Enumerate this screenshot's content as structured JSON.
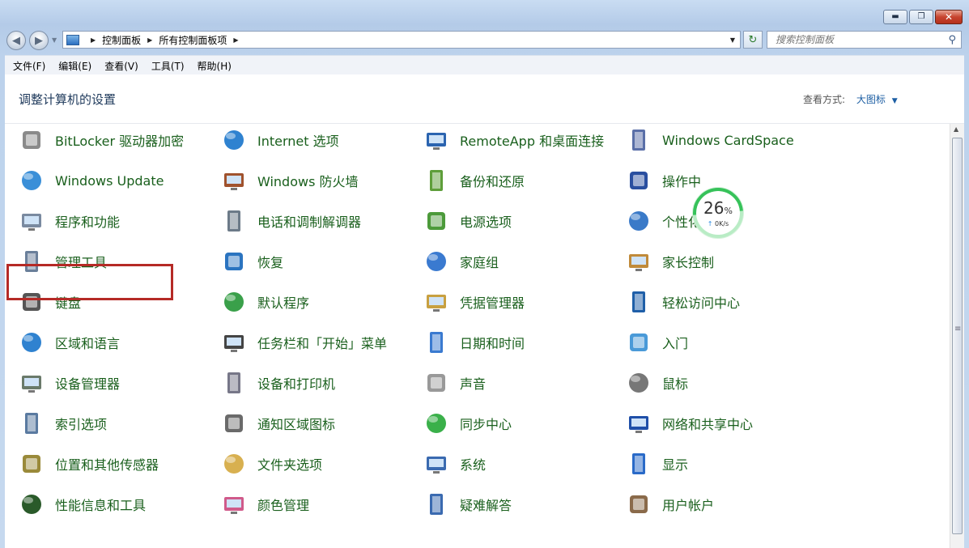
{
  "window": {
    "minimize_glyph": "▬",
    "maximize_glyph": "❐",
    "close_glyph": "✕"
  },
  "address_bar": {
    "crumbs": [
      "控制面板",
      "所有控制面板项"
    ]
  },
  "search": {
    "placeholder": "搜索控制面板"
  },
  "menu": [
    "文件(F)",
    "编辑(E)",
    "查看(V)",
    "工具(T)",
    "帮助(H)"
  ],
  "header": {
    "title": "调整计算机的设置",
    "view_by_label": "查看方式:",
    "view_by_value": "大图标"
  },
  "items": [
    [
      "BitLocker 驱动器加密",
      "Internet 选项",
      "RemoteApp 和桌面连接",
      "Windows CardSpace"
    ],
    [
      "Windows Update",
      "Windows 防火墙",
      "备份和还原",
      "操作中"
    ],
    [
      "程序和功能",
      "电话和调制解调器",
      "电源选项",
      "个性化"
    ],
    [
      "管理工具",
      "恢复",
      "家庭组",
      "家长控制"
    ],
    [
      "键盘",
      "默认程序",
      "凭据管理器",
      "轻松访问中心"
    ],
    [
      "区域和语言",
      "任务栏和「开始」菜单",
      "日期和时间",
      "入门"
    ],
    [
      "设备管理器",
      "设备和打印机",
      "声音",
      "鼠标"
    ],
    [
      "索引选项",
      "通知区域图标",
      "同步中心",
      "网络和共享中心"
    ],
    [
      "位置和其他传感器",
      "文件夹选项",
      "系统",
      "显示"
    ],
    [
      "性能信息和工具",
      "颜色管理",
      "疑难解答",
      "用户帐户"
    ]
  ],
  "net_monitor": {
    "percent": "26",
    "percent_unit": "%",
    "speed": "0K/s"
  },
  "colors": {
    "item_text": "#195f1c",
    "highlight": "#b52a26",
    "title": "#1e395b"
  }
}
